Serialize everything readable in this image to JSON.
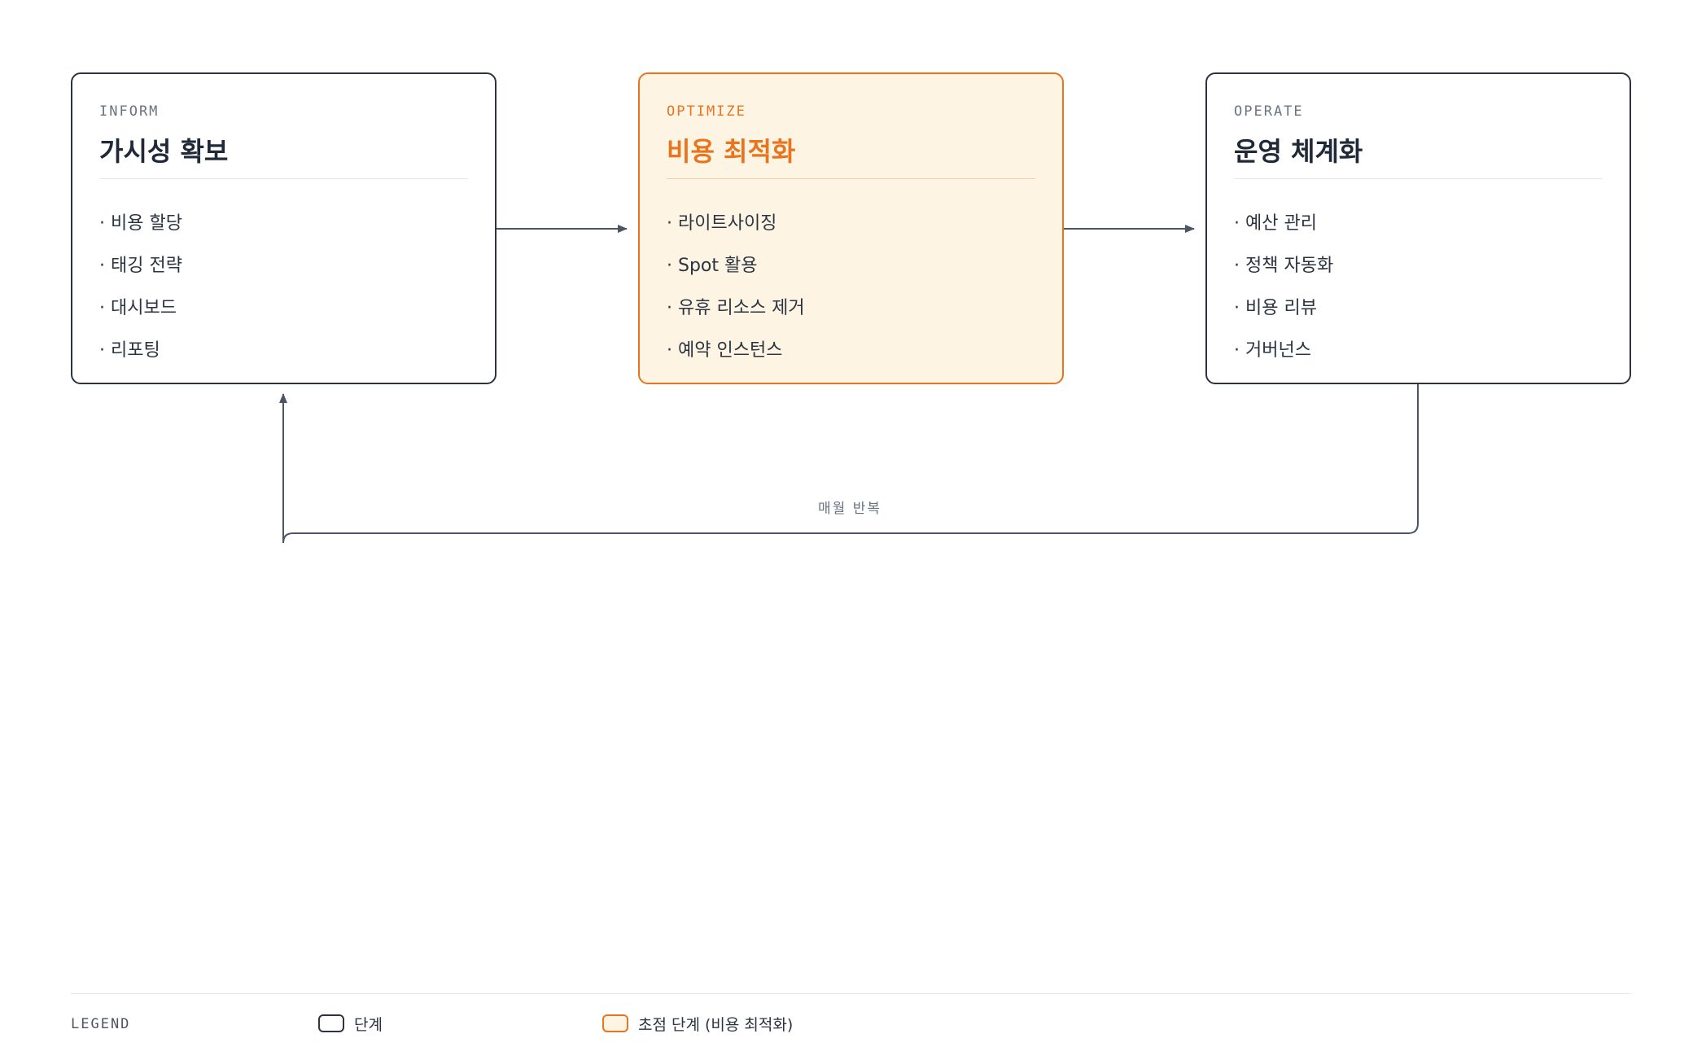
{
  "stages": [
    {
      "tag": "INFORM",
      "title": "가시성 확보",
      "items": [
        "· 비용 할당",
        "· 태깅 전략",
        "· 대시보드",
        "· 리포팅"
      ]
    },
    {
      "tag": "OPTIMIZE",
      "title": "비용 최적화",
      "items": [
        "· 라이트사이징",
        "· Spot 활용",
        "· 유휴 리소스 제거",
        "· 예약 인스턴스"
      ]
    },
    {
      "tag": "OPERATE",
      "title": "운영 체계화",
      "items": [
        "· 예산 관리",
        "· 정책 자동화",
        "· 비용 리뷰",
        "· 거버넌스"
      ]
    }
  ],
  "loop_label": "매월 반복",
  "legend": {
    "title": "LEGEND",
    "stage_label": "단계",
    "focus_label": "초점 단계 (비용 최적화)"
  },
  "colors": {
    "stroke": "#2b3440",
    "accent": "#e8741e",
    "accent_fill": "#fef4e4",
    "muted": "#6b7380"
  }
}
